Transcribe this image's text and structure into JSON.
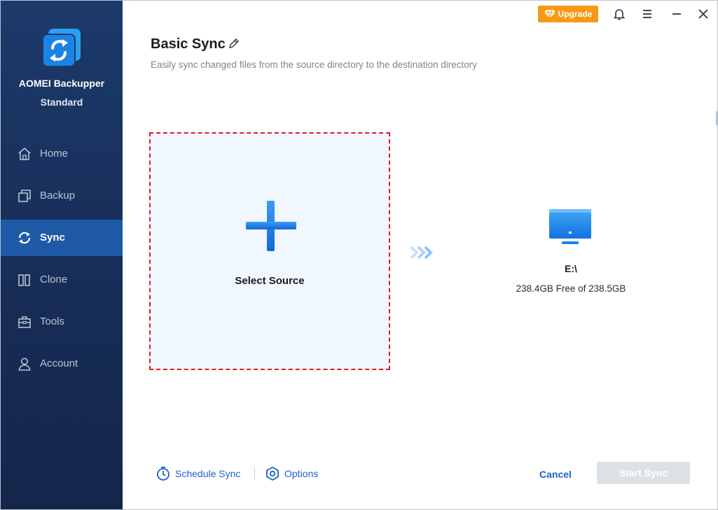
{
  "app": {
    "name": "AOMEI Backupper",
    "edition": "Standard"
  },
  "sidebar": {
    "items": [
      {
        "label": "Home",
        "icon": "home-icon",
        "active": false
      },
      {
        "label": "Backup",
        "icon": "backup-icon",
        "active": false
      },
      {
        "label": "Sync",
        "icon": "sync-icon",
        "active": true
      },
      {
        "label": "Clone",
        "icon": "clone-icon",
        "active": false
      },
      {
        "label": "Tools",
        "icon": "tools-icon",
        "active": false
      },
      {
        "label": "Account",
        "icon": "account-icon",
        "active": false
      }
    ]
  },
  "topbar": {
    "upgrade_label": "Upgrade"
  },
  "main": {
    "title": "Basic Sync",
    "subtitle": "Easily sync changed files from the source directory to the destination directory",
    "source_label": "Select Source",
    "destination": {
      "name": "E:\\",
      "info": "238.4GB Free of 238.5GB"
    }
  },
  "footer": {
    "schedule_label": "Schedule Sync",
    "options_label": "Options",
    "cancel_label": "Cancel",
    "start_label": "Start Sync"
  },
  "colors": {
    "sidebar_bg": "#182f5a",
    "active_nav": "#1f5aa6",
    "accent": "#1f5fc9",
    "upgrade": "#f59a18",
    "source_border": "#e31c1c",
    "start_disabled": "#dde1e6"
  }
}
